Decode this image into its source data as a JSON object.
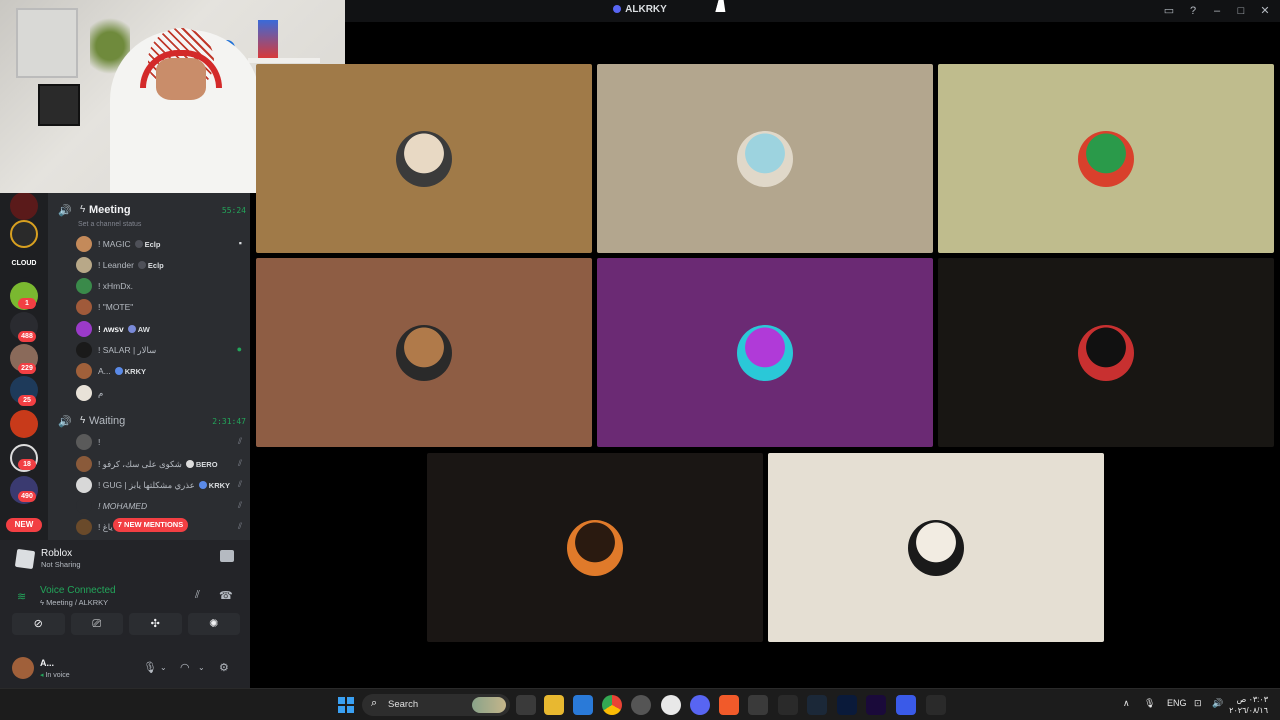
{
  "window": {
    "title": "ALKRKY"
  },
  "voice_channel": {
    "name": "Meeting",
    "timer": "55:24",
    "status_placeholder": "Set a channel status",
    "members": [
      {
        "name": "! MAGIC",
        "tag": "Eclp",
        "right_icon": "streaming-icon"
      },
      {
        "name": "! Leander",
        "tag": "Eclp",
        "right_icon": ""
      },
      {
        "name": "! xHmDx.",
        "tag": "",
        "right_icon": ""
      },
      {
        "name": "! \"MOTE\"",
        "tag": "",
        "right_icon": ""
      },
      {
        "name": "! ᴧᴡꜱᴠ",
        "tag": "AW",
        "right_icon": ""
      },
      {
        "name": "! SALAR | سالار",
        "tag": "",
        "right_icon": "green-dot"
      },
      {
        "name": "A...",
        "tag": "KRKY",
        "right_icon": ""
      },
      {
        "name": "م",
        "tag": "",
        "right_icon": ""
      }
    ]
  },
  "waiting_channel": {
    "name": "Waiting",
    "timer": "2:31:47",
    "members": [
      {
        "name": "!",
        "tag": "",
        "right_icon": "deafened-icon"
      },
      {
        "name": "! شكوى على سك، كرفو",
        "tag": "BERO",
        "right_icon": "deafened-icon"
      },
      {
        "name": "! GUG | عذري مشكلتها يابز",
        "tag": "KRKY",
        "right_icon": "deafened-icon"
      },
      {
        "name": "! MOHAMED",
        "tag": "",
        "right_icon": "deafened-icon"
      },
      {
        "name": "! ياغ",
        "tag": "",
        "right_icon": "deafened-icon"
      }
    ]
  },
  "rail": {
    "badges": [
      "1",
      "488",
      "229",
      "25",
      "18",
      "490"
    ],
    "new_label": "NEW",
    "mentions_label": "7 NEW MENTIONS"
  },
  "activity": {
    "name": "Roblox",
    "sub": "Not Sharing"
  },
  "voice_status": {
    "connected": "Voice Connected",
    "location": "Meeting / ALKRKY"
  },
  "user": {
    "name": "A...",
    "status": "In voice"
  },
  "tiles": [
    {
      "bg": "#a07a48",
      "avatar_colors": [
        "#e8d9c4",
        "#3b3b3b"
      ]
    },
    {
      "bg": "#b3a68e",
      "avatar_colors": [
        "#9dd3df",
        "#e0d8c9"
      ]
    },
    {
      "bg": "#bfbc8d",
      "avatar_colors": [
        "#2a9a4a",
        "#d9402c"
      ]
    },
    {
      "bg": "#8e5d44",
      "avatar_colors": [
        "#b07a4a",
        "#2a2a2a"
      ]
    },
    {
      "bg": "#6b2a74",
      "avatar_colors": [
        "#b03ad8",
        "#2ac8d8"
      ]
    },
    {
      "bg": "#181613",
      "avatar_colors": [
        "#111111",
        "#c83030"
      ]
    },
    {
      "bg": "#1a1614",
      "avatar_colors": [
        "#2a1a10",
        "#e07a2a"
      ]
    },
    {
      "bg": "#e5dfd3",
      "avatar_colors": [
        "#f2ece2",
        "#1a1a1a"
      ]
    }
  ],
  "taskbar": {
    "search": "Search",
    "lang": "ENG",
    "time": "٠٣:٠٣ ص",
    "date": "٢٠٢٦/٠٨/١٦"
  }
}
